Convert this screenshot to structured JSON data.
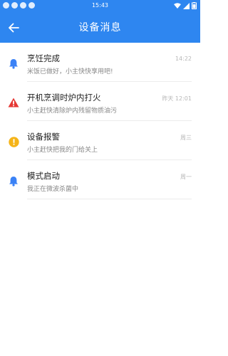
{
  "status_bar": {
    "time": "15:43"
  },
  "header": {
    "title": "设备消息",
    "back_icon": "arrow-left-icon"
  },
  "colors": {
    "primary": "#2e86f0",
    "bell": "#3b82f6",
    "warning_red": "#e53935",
    "alert_amber": "#f5b418"
  },
  "messages": [
    {
      "icon": "bell-icon",
      "title": "烹饪完成",
      "subtitle": "米饭已做好，小主快快享用吧!",
      "time": "14:22"
    },
    {
      "icon": "warning-triangle-icon",
      "title": "开机烹调时炉内打火",
      "subtitle": "小主赶快清除炉内残留物质油污",
      "time": "昨天 12:01"
    },
    {
      "icon": "alert-circle-icon",
      "title": "设备报警",
      "subtitle": "小主赶快把我的门给关上",
      "time": "周三"
    },
    {
      "icon": "bell-icon",
      "title": "模式启动",
      "subtitle": "我正在微波杀菌中",
      "time": "周一"
    }
  ]
}
